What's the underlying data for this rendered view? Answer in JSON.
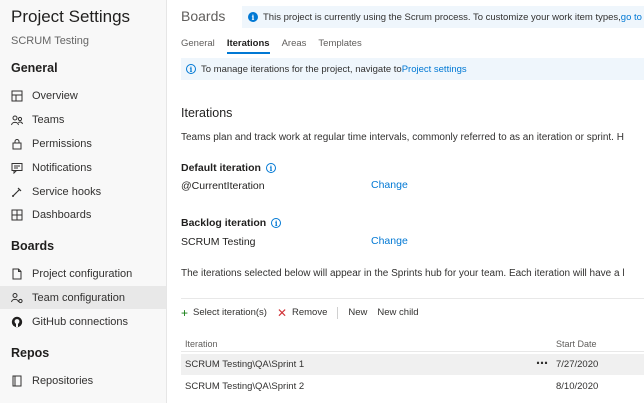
{
  "sidebar": {
    "title": "Project Settings",
    "project": "SCRUM Testing",
    "sections": [
      {
        "heading": "General",
        "items": [
          {
            "label": "Overview",
            "icon": "overview-icon"
          },
          {
            "label": "Teams",
            "icon": "teams-icon"
          },
          {
            "label": "Permissions",
            "icon": "lock-icon"
          },
          {
            "label": "Notifications",
            "icon": "notifications-icon"
          },
          {
            "label": "Service hooks",
            "icon": "service-hooks-icon"
          },
          {
            "label": "Dashboards",
            "icon": "dashboards-icon"
          }
        ]
      },
      {
        "heading": "Boards",
        "items": [
          {
            "label": "Project configuration",
            "icon": "document-icon"
          },
          {
            "label": "Team configuration",
            "icon": "team-config-icon",
            "active": true
          },
          {
            "label": "GitHub connections",
            "icon": "github-icon"
          }
        ]
      },
      {
        "heading": "Repos",
        "items": [
          {
            "label": "Repositories",
            "icon": "repositories-icon"
          }
        ]
      }
    ]
  },
  "main": {
    "title": "Boards",
    "banner_top": {
      "text": "This project is currently using the Scrum process. To customize your work item types, ",
      "link": "go to the pr"
    },
    "tabs": [
      {
        "label": "General"
      },
      {
        "label": "Iterations",
        "active": true
      },
      {
        "label": "Areas"
      },
      {
        "label": "Templates"
      }
    ],
    "banner_info": {
      "text": "To manage iterations for the project, navigate to ",
      "link": "Project settings"
    },
    "section_title": "Iterations",
    "description": "Teams plan and track work at regular time intervals, commonly referred to as an iteration or sprint. H",
    "default_iteration": {
      "label": "Default iteration",
      "value": "@CurrentIteration",
      "change": "Change"
    },
    "backlog_iteration": {
      "label": "Backlog iteration",
      "value": "SCRUM Testing",
      "change": "Change"
    },
    "sprints_note": "The iterations selected below will appear in the Sprints hub for your team. Each iteration will have a l",
    "toolbar": {
      "select": "Select iteration(s)",
      "remove": "Remove",
      "new": "New",
      "new_child": "New child"
    },
    "grid": {
      "columns": [
        "Iteration",
        "Start Date"
      ],
      "rows": [
        {
          "iteration": "SCRUM Testing\\QA\\Sprint 1",
          "start": "7/27/2020",
          "more": "⋯"
        },
        {
          "iteration": "SCRUM Testing\\QA\\Sprint 2",
          "start": "8/10/2020"
        }
      ]
    }
  },
  "colors": {
    "accent": "#0078d4",
    "remove": "#d13438",
    "add": "#107c10",
    "banner": "#eff6fc"
  }
}
